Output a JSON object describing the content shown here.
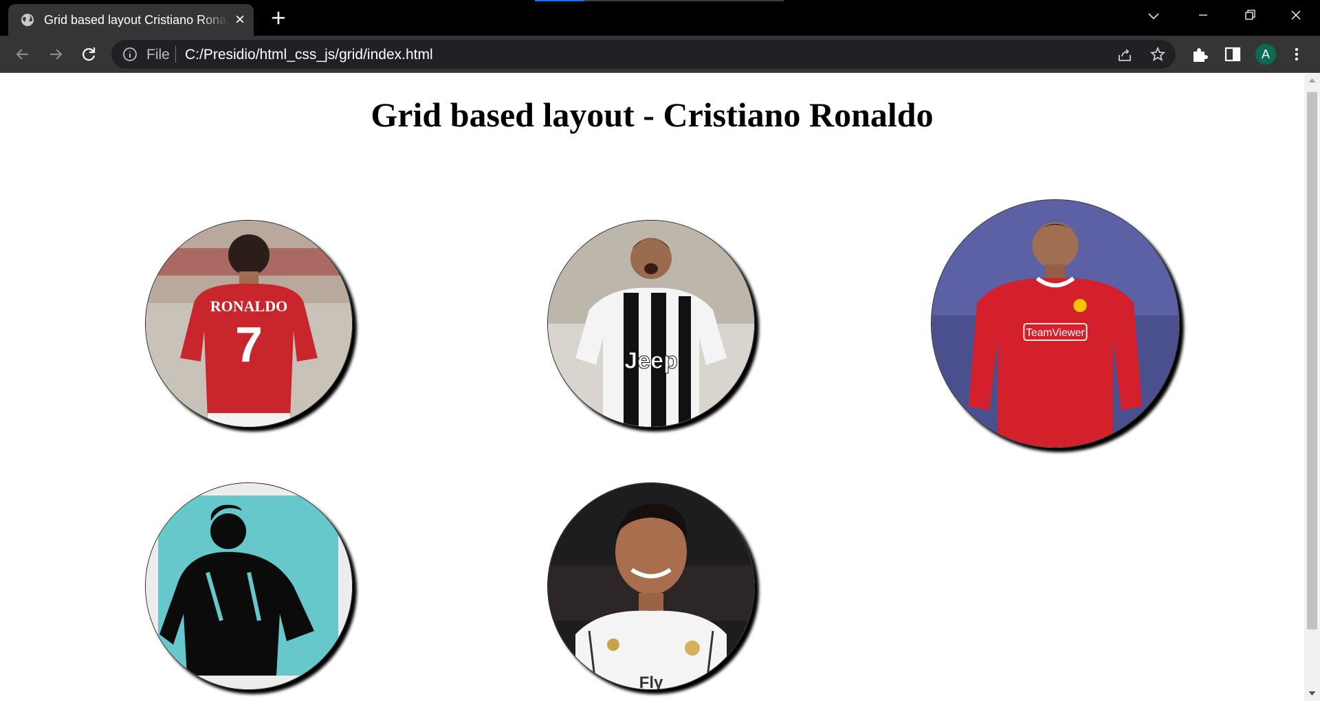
{
  "browser": {
    "tab": {
      "title": "Grid based layout Cristiano Ronaldo",
      "favicon": "globe-icon",
      "close_icon": "close-icon"
    },
    "new_tab_icon": "plus-icon",
    "tab_search_icon": "chevron-down-icon",
    "window_controls": [
      "minimize-icon",
      "restore-icon",
      "close-icon"
    ],
    "toolbar": {
      "back_icon": "arrow-left-icon",
      "forward_icon": "arrow-right-icon",
      "reload_icon": "reload-icon",
      "site_info_icon": "info-icon",
      "scheme_label": "File",
      "url": "C:/Presidio/html_css_js/grid/index.html",
      "share_icon": "share-icon",
      "bookmark_icon": "star-icon",
      "extensions_icon": "puzzle-icon",
      "side_panel_icon": "side-panel-icon",
      "profile_initial": "A",
      "menu_icon": "kebab-menu-icon"
    },
    "colors": {
      "titlebar": "#000000",
      "toolbar": "#353535",
      "omnibox": "#202124",
      "loading_accent": "#1a73e8",
      "avatar": "#0c6b52"
    }
  },
  "page": {
    "title": "Grid based layout - Cristiano Ronaldo",
    "photos": [
      {
        "name": "ronaldo-back-manchester-united",
        "shape": "circle",
        "jersey_text": "RONALDO",
        "number": "7"
      },
      {
        "name": "ronaldo-juventus-celebration",
        "shape": "circle",
        "sponsor": "Jeep"
      },
      {
        "name": "ronaldo-manchester-united-red-kit",
        "shape": "circle",
        "sponsor": "TeamViewer"
      },
      {
        "name": "ronaldo-stencil-art",
        "shape": "circle"
      },
      {
        "name": "ronaldo-real-madrid-portrait",
        "shape": "circle",
        "sponsor": "Fly"
      }
    ]
  }
}
